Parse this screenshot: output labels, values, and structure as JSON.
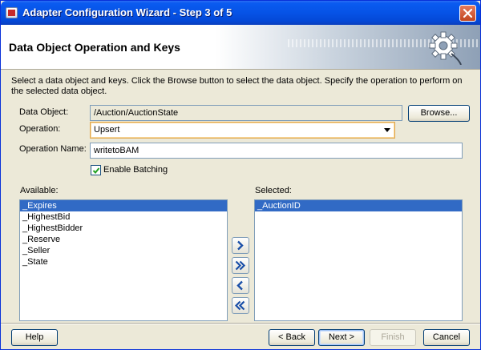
{
  "window": {
    "title": "Adapter Configuration Wizard - Step 3 of 5"
  },
  "header": {
    "title": "Data Object Operation and Keys"
  },
  "instructions": "Select a data object and keys.  Click the Browse button to select the data object.  Specify the operation to perform on the selected data object.",
  "form": {
    "data_object_label": "Data Object:",
    "data_object_value": "/Auction/AuctionState",
    "browse_label": "Browse...",
    "operation_label": "Operation:",
    "operation_value": "Upsert",
    "operation_name_label": "Operation Name:",
    "operation_name_value": "writetoBAM",
    "enable_batching_label": "Enable Batching",
    "enable_batching_checked": true
  },
  "available": {
    "label": "Available:",
    "items": [
      "_Expires",
      "_HighestBid",
      "_HighestBidder",
      "_Reserve",
      "_Seller",
      "_State"
    ],
    "selected_index": 0
  },
  "selected": {
    "label": "Selected:",
    "items": [
      "_AuctionID"
    ],
    "selected_index": 0
  },
  "footer": {
    "help": "Help",
    "back": "< Back",
    "next": "Next >",
    "finish": "Finish",
    "cancel": "Cancel"
  },
  "colors": {
    "title_bar": "#0653e6",
    "selection": "#316ac5",
    "dialog_bg": "#ece9d8",
    "close_button": "#c2461f"
  }
}
